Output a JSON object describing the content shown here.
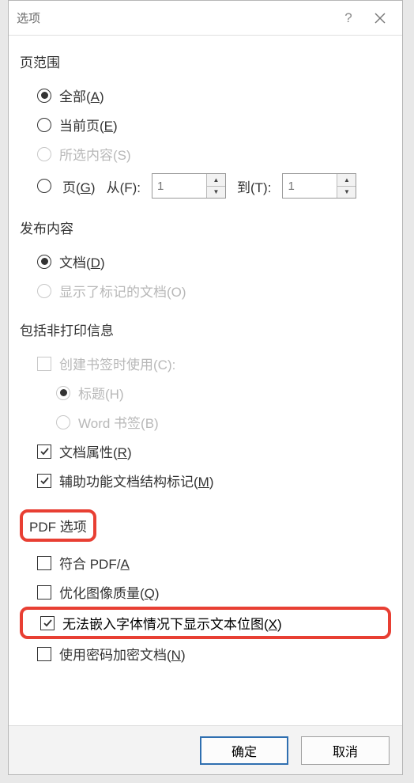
{
  "dialog": {
    "title": "选项",
    "help_label": "?",
    "sections": {
      "page_range": {
        "heading": "页范围",
        "all_label": "全部(",
        "all_key": "A",
        "current_label": "当前页(",
        "current_key": "E",
        "selection_label": "所选内容(S)",
        "pages_label": "页(",
        "pages_key": "G",
        "from_label": "从(F):",
        "from_value": "1",
        "to_label": "到(T):",
        "to_value": "1"
      },
      "publish": {
        "heading": "发布内容",
        "document_label": "文档(",
        "document_key": "D",
        "markup_label": "显示了标记的文档(O)"
      },
      "nonprint": {
        "heading": "包括非打印信息",
        "create_bm_label": "创建书签时使用(C):",
        "headings_label": "标题(H)",
        "word_bm_label": "Word 书签(B)",
        "doc_props_label": "文档属性(",
        "doc_props_key": "R",
        "acc_tags_label": "辅助功能文档结构标记(",
        "acc_tags_key": "M"
      },
      "pdf": {
        "heading": "PDF 选项",
        "pdfa_label": "符合 PDF/",
        "pdfa_key": "A",
        "optimize_label": "优化图像质量(",
        "optimize_key": "Q",
        "bitmap_label": "无法嵌入字体情况下显示文本位图(",
        "bitmap_key": "X",
        "encrypt_label": "使用密码加密文档(",
        "encrypt_key": "N"
      }
    },
    "buttons": {
      "ok": "确定",
      "cancel": "取消"
    }
  }
}
